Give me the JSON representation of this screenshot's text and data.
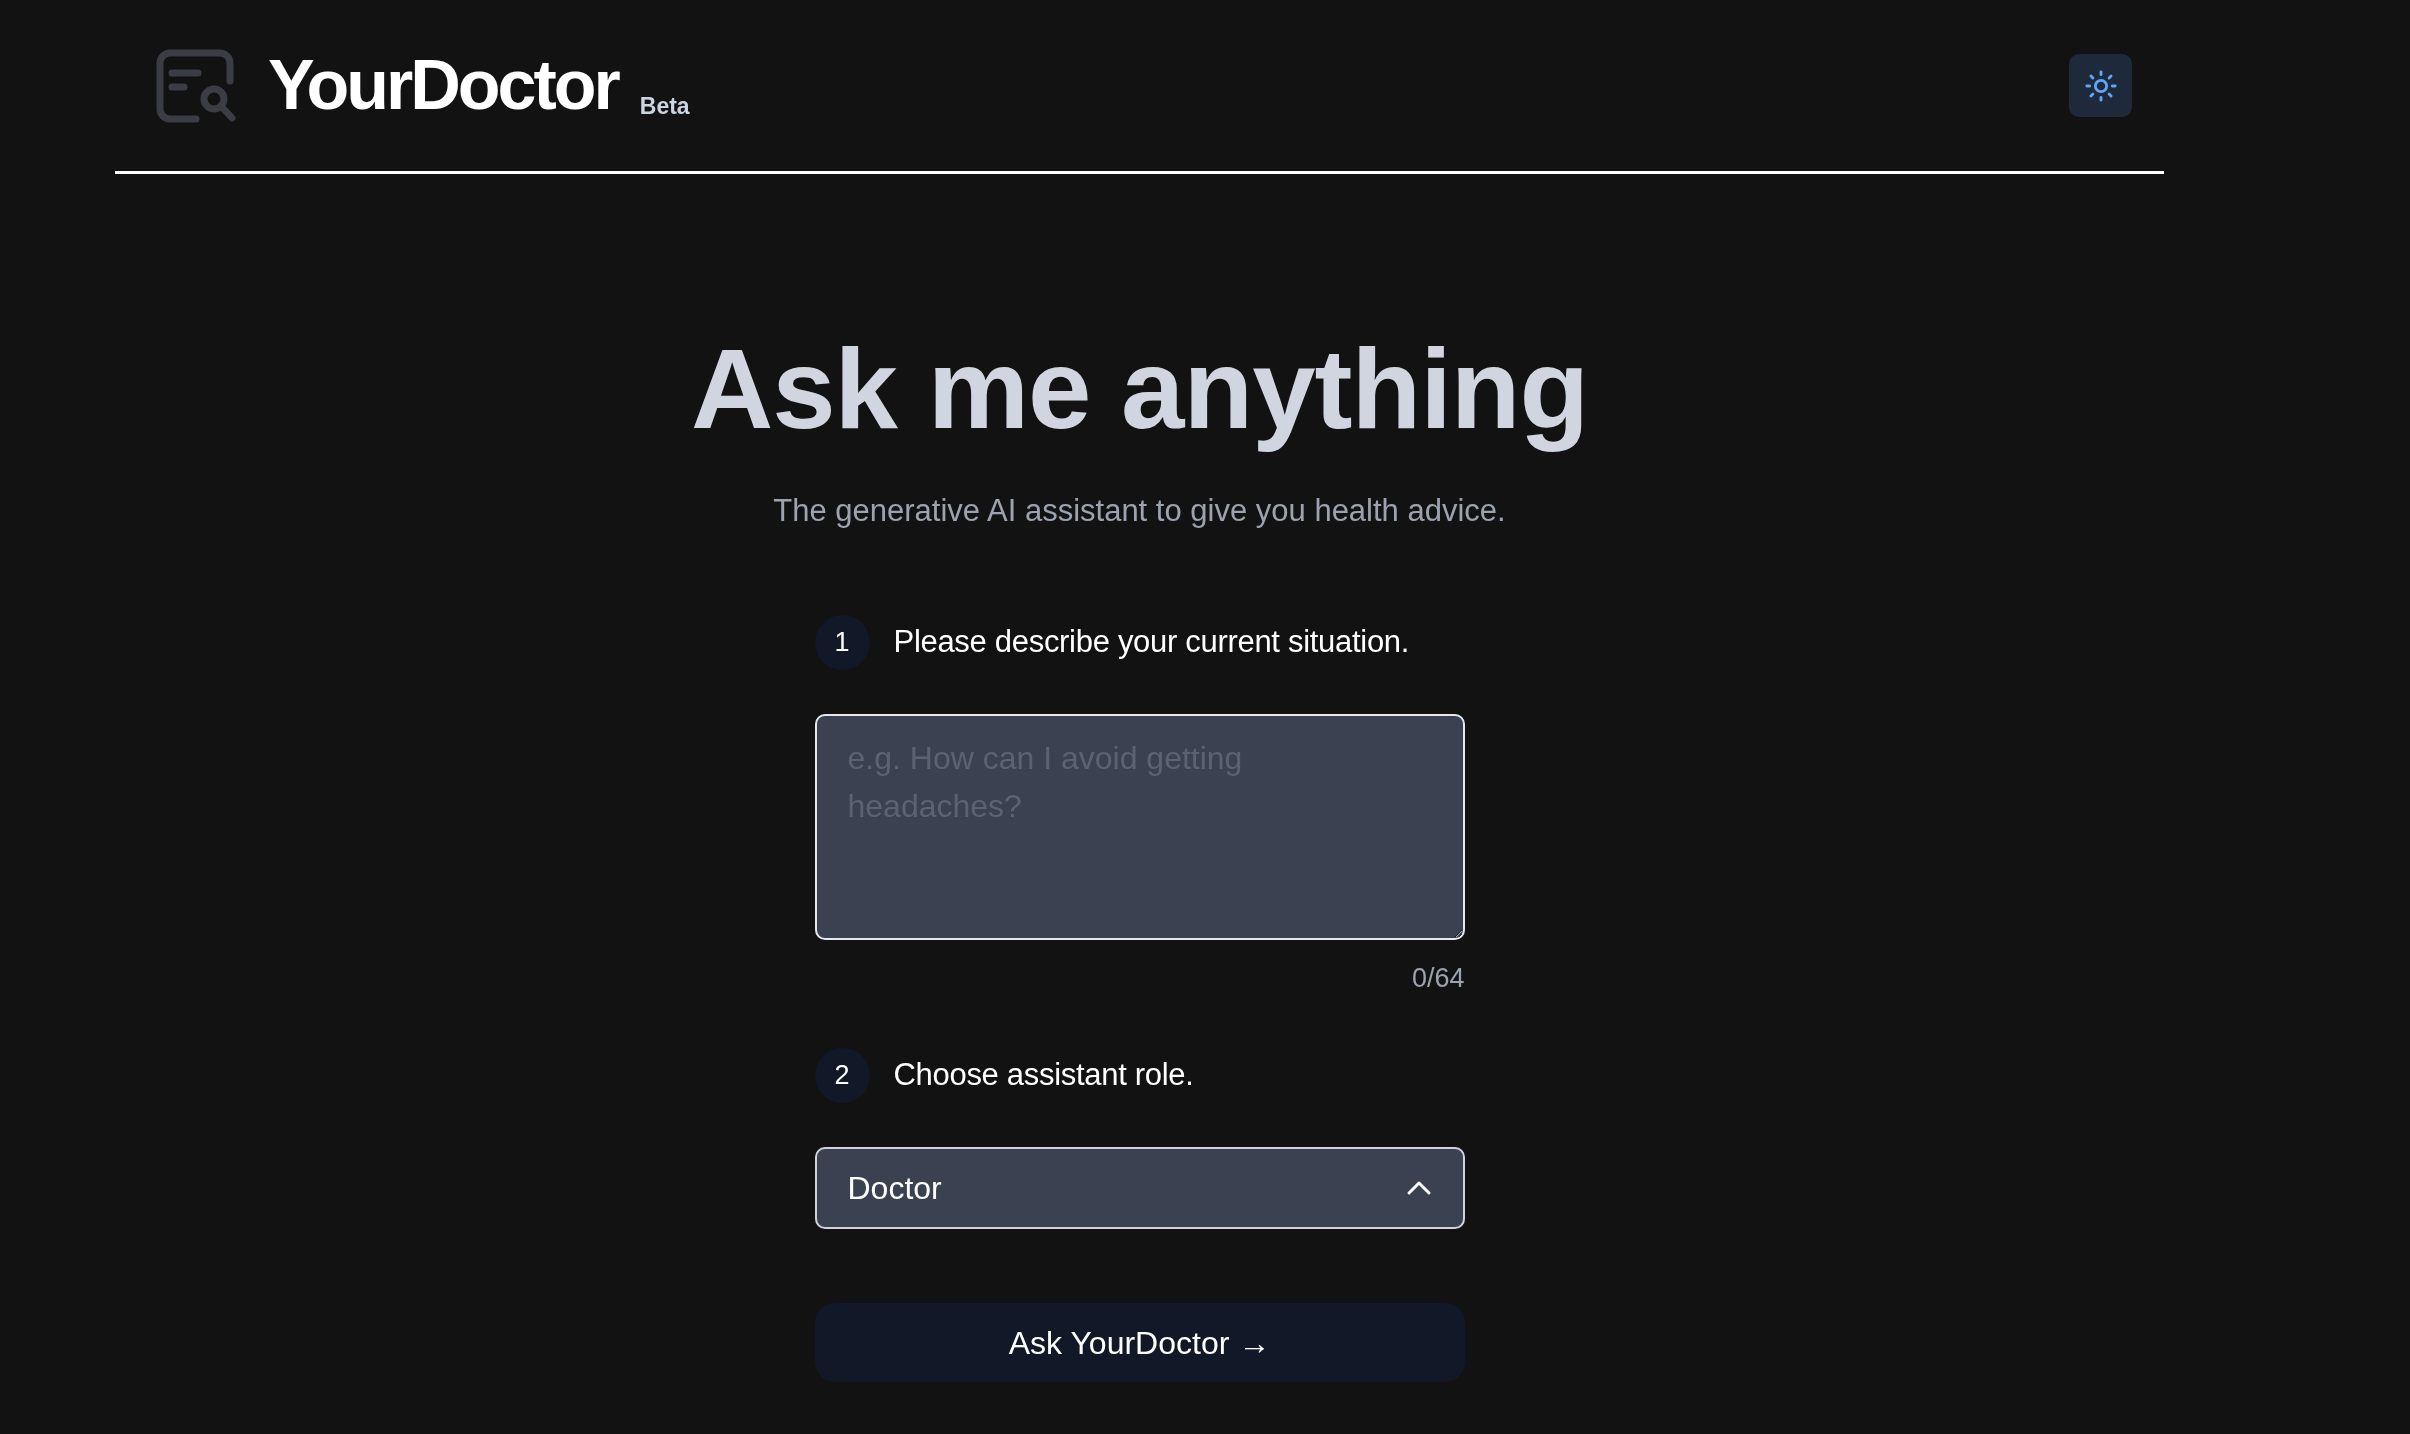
{
  "header": {
    "title": "YourDoctor",
    "badge": "Beta"
  },
  "hero": {
    "heading": "Ask me anything",
    "subtitle": "The generative AI assistant to give you health advice."
  },
  "steps": [
    {
      "number": "1",
      "label": "Please describe your current situation.",
      "kind": "textarea",
      "placeholder": "e.g. How can I avoid getting headaches?",
      "counter": "0/64"
    },
    {
      "number": "2",
      "label": "Choose assistant role.",
      "kind": "select",
      "value": "Doctor",
      "expanded": true
    }
  ],
  "submit": {
    "label": "Ask YourDoctor →"
  }
}
